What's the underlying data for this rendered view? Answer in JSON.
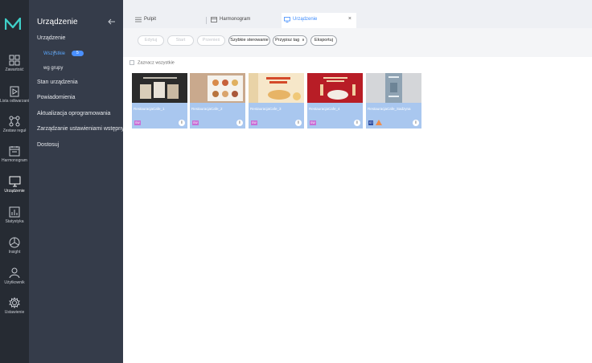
{
  "colors": {
    "rail_bg": "#262b33",
    "panel_bg": "#353c4a",
    "accent": "#3d8bfd",
    "card_bg": "#a9c7ef"
  },
  "rail": {
    "logo": "N-logo-icon",
    "items": [
      {
        "label": "Zawartość",
        "icon": "grid-icon"
      },
      {
        "label": "Lista odtwarzania",
        "icon": "playlist-icon"
      },
      {
        "label": "Zestaw reguł",
        "icon": "rules-icon"
      },
      {
        "label": "Harmonogram",
        "icon": "calendar-icon"
      },
      {
        "label": "Urządzenie",
        "icon": "monitor-icon"
      },
      {
        "label": "Statystyka",
        "icon": "bar-chart-icon"
      },
      {
        "label": "Insight",
        "icon": "pie-icon"
      },
      {
        "label": "Użytkownik",
        "icon": "user-icon"
      },
      {
        "label": "Ustawienie",
        "icon": "gear-icon"
      }
    ]
  },
  "panel": {
    "title": "Urządzenie",
    "items": [
      {
        "label": "Urządzenie"
      },
      {
        "label": "Stan urządzenia"
      },
      {
        "label": "Powiadomienia"
      },
      {
        "label": "Aktualizacja oprogramowania"
      },
      {
        "label": "Zarządzanie ustawieniami wstępnymi"
      },
      {
        "label": "Dostosuj"
      }
    ],
    "sub": {
      "all_label": "Wszystkie",
      "all_count": "5",
      "group_label": "wg grupy"
    }
  },
  "tabs": [
    {
      "label": "Pulpit",
      "icon": "list-icon"
    },
    {
      "label": "Harmonogram",
      "icon": "calendar-icon"
    },
    {
      "label": "Urządzenie",
      "icon": "monitor-icon",
      "active": true
    }
  ],
  "tab_close": "×",
  "toolbar": {
    "edit": "Edytuj",
    "start": "Start",
    "move": "Przenieś",
    "quick_control": "Szybkie sterowanie",
    "assign_tag": "Przypisz tag",
    "export": "Eksportuj"
  },
  "select_all": "Zaznacz wszystkie",
  "devices": [
    {
      "name": "RestauracjaCafe_1",
      "tag": "SW",
      "tag_color": "#c86ed6"
    },
    {
      "name": "RestauracjaCafe_2",
      "tag": "SW",
      "tag_color": "#c86ed6"
    },
    {
      "name": "RestauracjaCafe_3",
      "tag": "SW",
      "tag_color": "#c86ed6"
    },
    {
      "name": "RestauracjaCafe_4",
      "tag": "SW",
      "tag_color": "#c86ed6"
    },
    {
      "name": "RestauracjaCafe_Sadzyna",
      "tag": "S7",
      "tag_color": "#2f4fa3"
    }
  ],
  "info_glyph": "i"
}
